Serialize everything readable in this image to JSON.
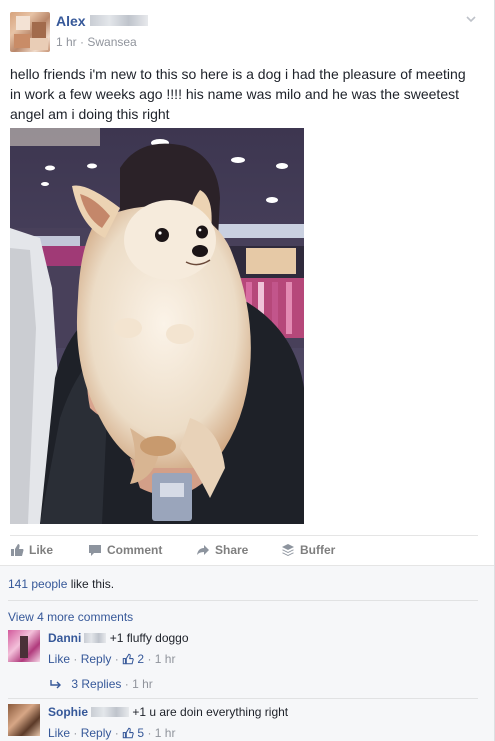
{
  "post": {
    "author": "Alex",
    "time": "1 hr",
    "location": "Swansea",
    "meta_sep": " · ",
    "text": "hello friends i'm new to this so here is a dog i had the pleasure of meeting in work a few weeks ago !!!! his name was milo and he was the sweetest angel am i doing this right"
  },
  "actions": {
    "like": "Like",
    "comment": "Comment",
    "share": "Share",
    "buffer": "Buffer"
  },
  "likes": {
    "count_text": "141 people",
    "suffix": " like this."
  },
  "more_comments": "View 4 more comments",
  "comments": [
    {
      "name": "Danni",
      "text": "+1 fluffy doggo",
      "like": "Like",
      "reply": "Reply",
      "like_count": "2",
      "time": "1 hr"
    },
    {
      "name": "Sophie",
      "text": "+1 u are doin everything right",
      "like": "Like",
      "reply": "Reply",
      "like_count": "5",
      "time": "1 hr"
    }
  ],
  "replies": {
    "label": "3 Replies",
    "time": "1 hr"
  },
  "colors": {
    "link": "#365899",
    "muted": "#90949c",
    "background": "#f6f7f9"
  },
  "icons": [
    "chevron-down-icon",
    "like-thumb-icon",
    "comment-bubble-icon",
    "share-arrow-icon",
    "buffer-stack-icon",
    "reply-arrow-icon"
  ]
}
